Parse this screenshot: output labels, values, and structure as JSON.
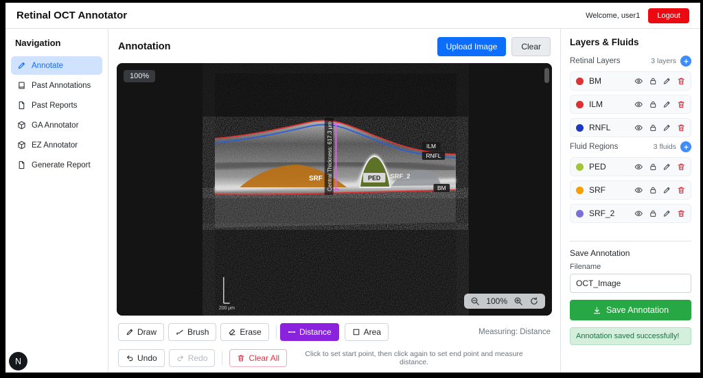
{
  "n_badge": "N",
  "header": {
    "title": "Retinal OCT Annotator",
    "welcome": "Welcome, user1",
    "logout": "Logout"
  },
  "nav": {
    "title": "Navigation",
    "items": [
      {
        "label": "Annotate"
      },
      {
        "label": "Past Annotations"
      },
      {
        "label": "Past Reports"
      },
      {
        "label": "GA Annotator"
      },
      {
        "label": "EZ Annotator"
      },
      {
        "label": "Generate Report"
      }
    ]
  },
  "annotation": {
    "title": "Annotation",
    "upload": "Upload Image",
    "clear": "Clear",
    "viewer": {
      "zoom_badge": "100%",
      "zoom_display": "100%",
      "scale_label": "200 μm",
      "central_thickness": "Central Thickness: 617.3 μm",
      "labels": {
        "ilm": "ILM",
        "rnfl": "RNFL",
        "bm": "BM",
        "srf": "SRF",
        "ped": "PED",
        "srf2": "SRF_2"
      }
    },
    "tools": {
      "draw": "Draw",
      "brush": "Brush",
      "erase": "Erase",
      "distance": "Distance",
      "area": "Area",
      "measuring": "Measuring: Distance",
      "undo": "Undo",
      "redo": "Redo",
      "clear_all": "Clear All",
      "hint": "Click to set start point, then click again to set end point and measure distance."
    }
  },
  "panel": {
    "title": "Layers & Fluids",
    "layers": {
      "title": "Retinal Layers",
      "count": "3 layers",
      "items": [
        {
          "name": "BM",
          "color": "#e03131"
        },
        {
          "name": "ILM",
          "color": "#e03131"
        },
        {
          "name": "RNFL",
          "color": "#1d39c4"
        }
      ]
    },
    "fluids": {
      "title": "Fluid Regions",
      "count": "3 fluids",
      "items": [
        {
          "name": "PED",
          "color": "#a2c437"
        },
        {
          "name": "SRF",
          "color": "#f59f00"
        },
        {
          "name": "SRF_2",
          "color": "#7a70d8"
        }
      ]
    },
    "save": {
      "title": "Save Annotation",
      "filename_label": "Filename",
      "filename_value": "OCT_Image",
      "button": "Save Annotation",
      "success": "Annotation saved successfully!"
    }
  }
}
